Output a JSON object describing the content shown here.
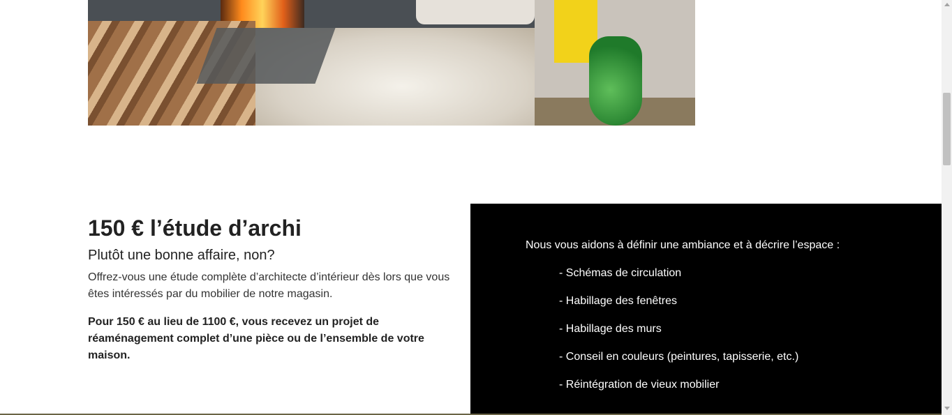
{
  "hero_image": {
    "icon": "fireplace-living-room-photo"
  },
  "offer": {
    "title": "150 € l’étude d’archi",
    "subtitle": "Plutôt une bonne affaire, non?",
    "description": "Offrez-vous une étude complète d’architecte d’intérieur dès lors que vous êtes intéressés par du mobilier de notre magasin.",
    "highlight": "Pour 150 € au lieu de 1100 €, vous recevez un projet de réaménagement complet d’une pièce ou de l’ensemble de votre maison."
  },
  "services": {
    "intro": "Nous vous aidons à définir une ambiance et à décrire l’espace :",
    "items": [
      "- Schémas de circulation",
      "- Habillage des fenêtres",
      "- Habillage des murs",
      "- Conseil en couleurs (peintures, tapisserie, etc.)",
      "- Réintégration de vieux mobilier"
    ]
  },
  "colors": {
    "panel_bg": "#000000",
    "panel_text": "#ffffff",
    "text": "#222222"
  }
}
